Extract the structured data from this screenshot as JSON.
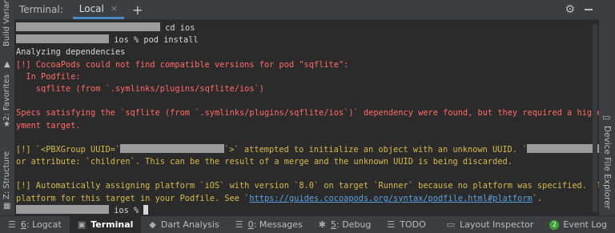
{
  "left_panel": {
    "items": [
      {
        "label": "Build Variants"
      },
      {
        "label": "2: Favorites"
      },
      {
        "label": "Z: Structure"
      }
    ]
  },
  "right_panel": {
    "label": "Device File Explorer"
  },
  "terminal_header": {
    "title": "Terminal:",
    "tab_label": "Local",
    "close_glyph": "×",
    "add_glyph": "+",
    "settings_glyph": "⚙"
  },
  "terminal": {
    "line1_cmd": " cd ios",
    "line2_cmd": " ios % pod install",
    "line3": "Analyzing dependencies",
    "line4": "[!] CocoaPods could not find compatible versions for pod \"sqflite\":",
    "line5": "  In Podfile:",
    "line6": "    sqflite (from `.symlinks/plugins/sqflite/ios`)",
    "line8": "Specs satisfying the `sqflite (from `.symlinks/plugins/sqflite/ios`)` dependency were found, but they required a higher minimum deplo",
    "line9": "yment target.",
    "line11_a": "[!] `<PBXGroup UUID=`",
    "line11_b": "`>` attempted to initialize an object with an unknown UUID. `",
    "line11_c": "` f",
    "line12": "or attribute: `children`. This can be the result of a merge and the unknown UUID is being discarded.",
    "line14": "[!] Automatically assigning platform `iOS` with version `8.0` on target `Runner` because no platform was specified. Please specify a",
    "line15_a": "platform for this target in your Podfile. See `",
    "line15_link": "https://guides.cocoapods.org/syntax/podfile.html#platform",
    "line15_b": "`.",
    "line16_cmd": " ios % "
  },
  "status_bar": {
    "items": [
      {
        "num": "6",
        "label": ": Logcat"
      },
      {
        "label": "Terminal"
      },
      {
        "label": "Dart Analysis"
      },
      {
        "num": "0",
        "label": ": Messages"
      },
      {
        "num": "5",
        "label": ": Debug"
      },
      {
        "label": "TODO"
      },
      {
        "label": "Layout Inspector"
      },
      {
        "badge": "2",
        "label": "Event Log"
      }
    ]
  }
}
